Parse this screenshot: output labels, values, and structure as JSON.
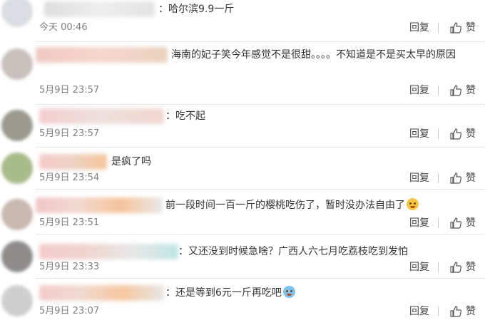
{
  "actions": {
    "reply_label": "回复",
    "like_label": "赞"
  },
  "comments": [
    {
      "text": "：哈尔滨9.9一斤",
      "time": "今天 00:46"
    },
    {
      "text": "海南的妃子笑今年感觉不是很甜。。。。不知道是不是买太早的原因",
      "time": "5月9日 23:57"
    },
    {
      "text": "：吃不起",
      "time": "5月9日 23:57"
    },
    {
      "text": "是疯了吗",
      "time": "5月9日 23:54"
    },
    {
      "text": "前一段时间一百一斤的樱桃吃伤了，暂时没办法自由了",
      "time": "5月9日 23:51"
    },
    {
      "text": "：又还没到时候急啥？广西人六七月吃荔枝吃到发怕",
      "time": "5月9日 23:33"
    },
    {
      "text": "：还是等到6元一斤再吃吧",
      "time": "5月9日 23:07"
    }
  ]
}
